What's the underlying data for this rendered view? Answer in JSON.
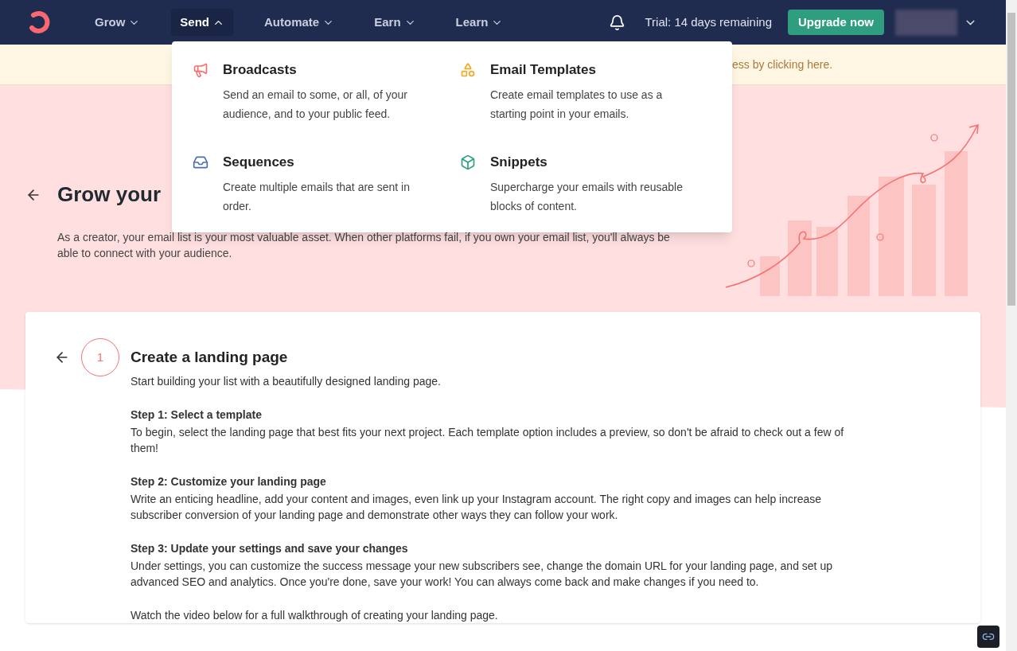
{
  "nav": {
    "items": [
      {
        "label": "Grow",
        "expanded": false
      },
      {
        "label": "Send",
        "expanded": true
      },
      {
        "label": "Automate",
        "expanded": false
      },
      {
        "label": "Earn",
        "expanded": false
      },
      {
        "label": "Learn",
        "expanded": false
      }
    ],
    "trial": "Trial: 14 days remaining",
    "upgrade": "Upgrade now"
  },
  "banner": {
    "text": "ess by clicking here."
  },
  "dropdown": {
    "items": [
      {
        "kind": "megaphone",
        "title": "Broadcasts",
        "description": "Send an email to some, or all, of your audience, and to your public feed."
      },
      {
        "kind": "shapes",
        "title": "Email Templates",
        "description": "Create email templates to use as a starting point in your emails."
      },
      {
        "kind": "inbox",
        "title": "Sequences",
        "description": "Create multiple emails that are sent in order."
      },
      {
        "kind": "cube",
        "title": "Snippets",
        "description": "Supercharge your emails with reusable blocks of content."
      }
    ]
  },
  "hero": {
    "title": "Grow your",
    "intro": "As a creator, your email list is your most valuable asset. When other platforms fail, if you own your email list, you'll always be able to connect with your audience."
  },
  "step": {
    "number": "1",
    "title": "Create a landing page",
    "subtitle": "Start building your list with a beautifully designed landing page.",
    "sections": [
      {
        "heading": "Step 1: Select a template",
        "body": "To begin, select the landing page that best fits your next project. Each template option includes a preview, so don't be afraid to check out a few of them!"
      },
      {
        "heading": "Step 2: Customize your landing page",
        "body": "Write an enticing headline, add your content and images, even link up your Instagram account. The right copy and images can help increase subscriber conversion of your landing page and demonstrate other ways they can follow your work."
      },
      {
        "heading": "Step 3: Update your settings and save your changes",
        "body": "Under settings, you can customize the success message your new subscribers see, change the domain URL for your landing page, and set up advanced SEO and analytics. Once you're done, save your work! You can always come back and make changes if you need to."
      }
    ],
    "footer": "Watch the video below for a full walkthrough of creating your landing page."
  }
}
